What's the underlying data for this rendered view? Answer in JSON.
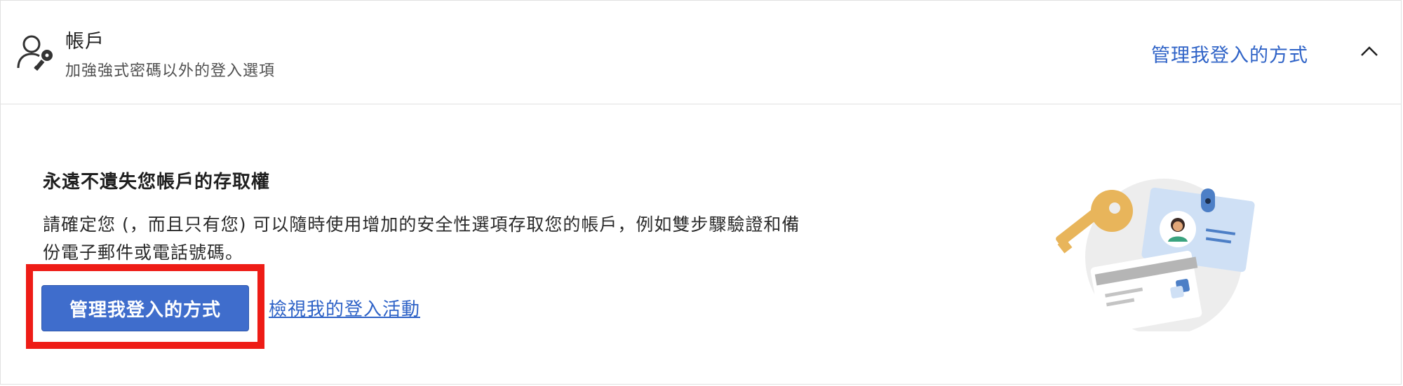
{
  "header": {
    "title": "帳戶",
    "subtitle": "加強強式密碼以外的登入選項",
    "manage_link": "管理我登入的方式",
    "icon": "user-key-icon",
    "collapse_icon": "chevron-up-icon"
  },
  "main": {
    "heading": "永遠不遺失您帳戶的存取權",
    "description": "請確定您 (，而且只有您) 可以隨時使用增加的安全性選項存取您的帳戶，例如雙步驟驗證和備份電子郵件或電話號碼。",
    "primary_button": "管理我登入的方式",
    "activity_link": "檢視我的登入活動",
    "illustration": "security-illustration"
  },
  "colors": {
    "link": "#2f63c7",
    "primary_button": "#3f6dcc",
    "highlight": "#ee1c16"
  }
}
